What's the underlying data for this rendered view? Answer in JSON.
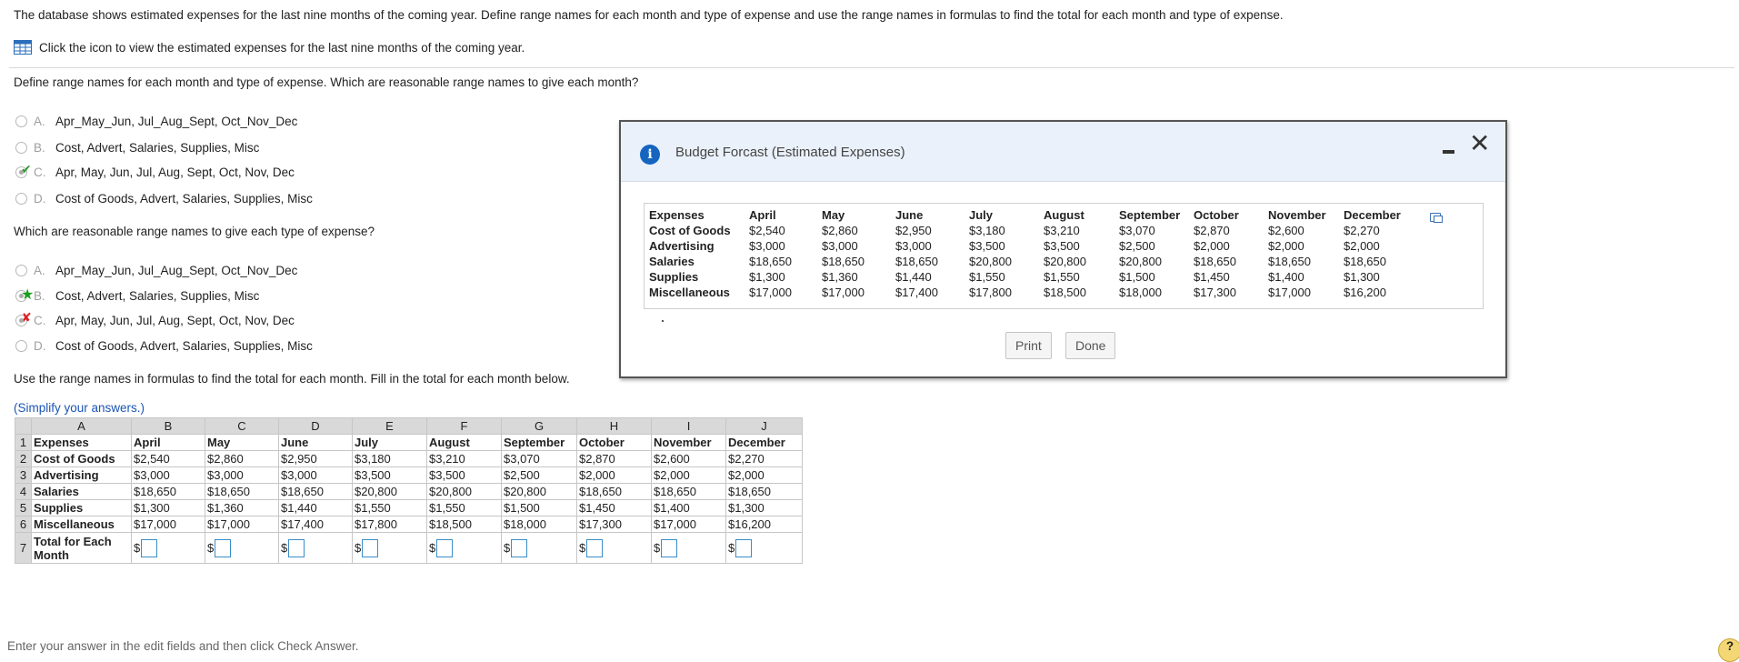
{
  "intro": "The database shows estimated expenses for the last nine months of the coming year. Define range names for each month and type of expense and use the range names in formulas to find the total for each month and type of expense.",
  "icon_line": "Click the icon to view the estimated expenses for the last nine months of the coming year.",
  "question1": {
    "prompt": "Define range names for each month and type of expense. Which are reasonable range names to give each month?",
    "options": [
      {
        "letter": "A.",
        "text": "Apr_May_Jun, Jul_Aug_Sept, Oct_Nov_Dec"
      },
      {
        "letter": "B.",
        "text": "Cost, Advert, Salaries, Supplies, Misc"
      },
      {
        "letter": "C.",
        "text": "Apr, May, Jun, Jul, Aug, Sept, Oct, Nov, Dec"
      },
      {
        "letter": "D.",
        "text": "Cost of Goods, Advert, Salaries, Supplies, Misc"
      }
    ]
  },
  "question2": {
    "prompt": "Which are reasonable range names to give each type of expense?",
    "options": [
      {
        "letter": "A.",
        "text": "Apr_May_Jun, Jul_Aug_Sept, Oct_Nov_Dec"
      },
      {
        "letter": "B.",
        "text": "Cost, Advert, Salaries, Supplies, Misc"
      },
      {
        "letter": "C.",
        "text": "Apr, May, Jun, Jul, Aug, Sept, Oct, Nov, Dec"
      },
      {
        "letter": "D.",
        "text": "Cost of Goods, Advert, Salaries, Supplies, Misc"
      }
    ]
  },
  "question3": {
    "prompt": "Use the range names in formulas to find the total for each month. Fill in the total for each month below.",
    "simplify": "(Simplify your answers.)"
  },
  "sheet": {
    "col_headers": [
      "A",
      "B",
      "C",
      "D",
      "E",
      "F",
      "G",
      "H",
      "I",
      "J"
    ],
    "row_numbers": [
      "1",
      "2",
      "3",
      "4",
      "5",
      "6",
      "7"
    ],
    "header_row": [
      "Expenses",
      "April",
      "May",
      "June",
      "July",
      "August",
      "September",
      "October",
      "November",
      "December"
    ],
    "rows": [
      [
        "Cost of Goods",
        "$2,540",
        "$2,860",
        "$2,950",
        "$3,180",
        "$3,210",
        "$3,070",
        "$2,870",
        "$2,600",
        "$2,270"
      ],
      [
        "Advertising",
        "$3,000",
        "$3,000",
        "$3,000",
        "$3,500",
        "$3,500",
        "$2,500",
        "$2,000",
        "$2,000",
        "$2,000"
      ],
      [
        "Salaries",
        "$18,650",
        "$18,650",
        "$18,650",
        "$20,800",
        "$20,800",
        "$20,800",
        "$18,650",
        "$18,650",
        "$18,650"
      ],
      [
        "Supplies",
        "$1,300",
        "$1,360",
        "$1,440",
        "$1,550",
        "$1,550",
        "$1,500",
        "$1,450",
        "$1,400",
        "$1,300"
      ],
      [
        "Miscellaneous",
        "$17,000",
        "$17,000",
        "$17,400",
        "$17,800",
        "$18,500",
        "$18,000",
        "$17,300",
        "$17,000",
        "$16,200"
      ]
    ],
    "total_label": "Total for Each Month",
    "dollar": "$"
  },
  "modal": {
    "title": "Budget Forcast (Estimated Expenses)",
    "print_label": "Print",
    "done_label": "Done"
  },
  "bottom_note": "Enter your answer in the edit fields and then click Check Answer.",
  "help_label": "?"
}
